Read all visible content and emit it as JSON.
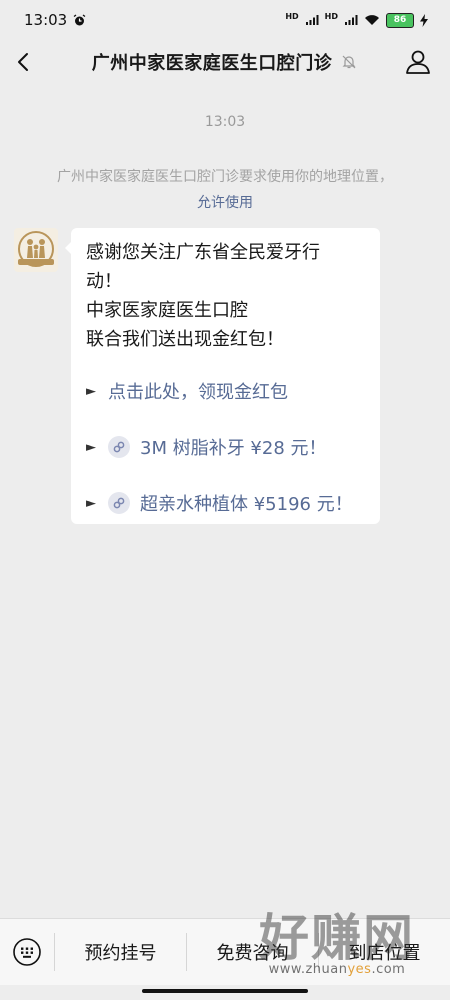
{
  "status_bar": {
    "time": "13:03",
    "battery": "86"
  },
  "header": {
    "title": "广州中家医家庭医生口腔门诊"
  },
  "chat": {
    "timestamp": "13:03",
    "system_text": "广州中家医家庭医生口腔门诊要求使用你的地理位置，",
    "system_action": "允许使用",
    "message": {
      "lines": [
        "感谢您关注广东省全民爱牙行",
        "动！",
        "中家医家庭医生口腔",
        "联合我们送出现金红包！"
      ],
      "links": [
        {
          "arrow": "►",
          "text": "点击此处，领现金红包"
        },
        {
          "arrow": "►",
          "text": "3M 树脂补牙 ¥28 元！"
        },
        {
          "arrow": "►",
          "text": "超亲水种植体 ¥5196 元！"
        }
      ]
    }
  },
  "bottom_menu": [
    "预约挂号",
    "免费咨询",
    "到店位置"
  ],
  "watermark": {
    "big": "好赚网",
    "url_prefix": "www.zhuan",
    "url_accent": "yes",
    "url_suffix": ".com"
  },
  "colors": {
    "link": "#576b95",
    "background": "#ededed",
    "battery": "#49c35f"
  }
}
